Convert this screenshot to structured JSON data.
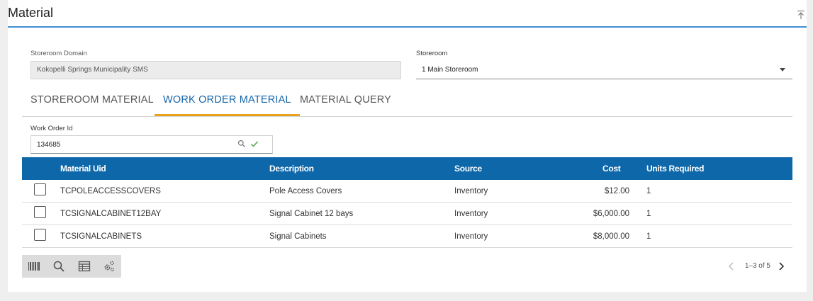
{
  "panel": {
    "title": "Material"
  },
  "form": {
    "domain_label": "Storeroom Domain",
    "domain_value": "Kokopelli Springs Municipality SMS",
    "storeroom_label": "Storeroom",
    "storeroom_value": "1 Main Storeroom"
  },
  "tabs": [
    {
      "label": "STOREROOM MATERIAL",
      "active": false
    },
    {
      "label": "WORK ORDER MATERIAL",
      "active": true
    },
    {
      "label": "MATERIAL QUERY",
      "active": false
    }
  ],
  "work_order": {
    "label": "Work Order Id",
    "value": "134685"
  },
  "table": {
    "columns": [
      "Material Uid",
      "Description",
      "Source",
      "Cost",
      "Units Required"
    ],
    "rows": [
      {
        "uid": "TCPOLEACCESSCOVERS",
        "description": "Pole Access Covers",
        "source": "Inventory",
        "cost": "$12.00",
        "units": "1",
        "checked": false
      },
      {
        "uid": "TCSIGNALCABINET12BAY",
        "description": "Signal Cabinet 12 bays",
        "source": "Inventory",
        "cost": "$6,000.00",
        "units": "1",
        "checked": false
      },
      {
        "uid": "TCSIGNALCABINETS",
        "description": "Signal Cabinets",
        "source": "Inventory",
        "cost": "$8,000.00",
        "units": "1",
        "checked": false
      }
    ]
  },
  "toolbar": {
    "icons": [
      "barcode-icon",
      "search-icon",
      "table-icon",
      "settings-icon"
    ]
  },
  "pager": {
    "text": "1–3 of 5"
  },
  "colors": {
    "header_blue": "#0d67a9",
    "active_tab_text": "#1565a8",
    "active_tab_underline": "#e9a21c",
    "title_rule": "#3f8fd2"
  }
}
